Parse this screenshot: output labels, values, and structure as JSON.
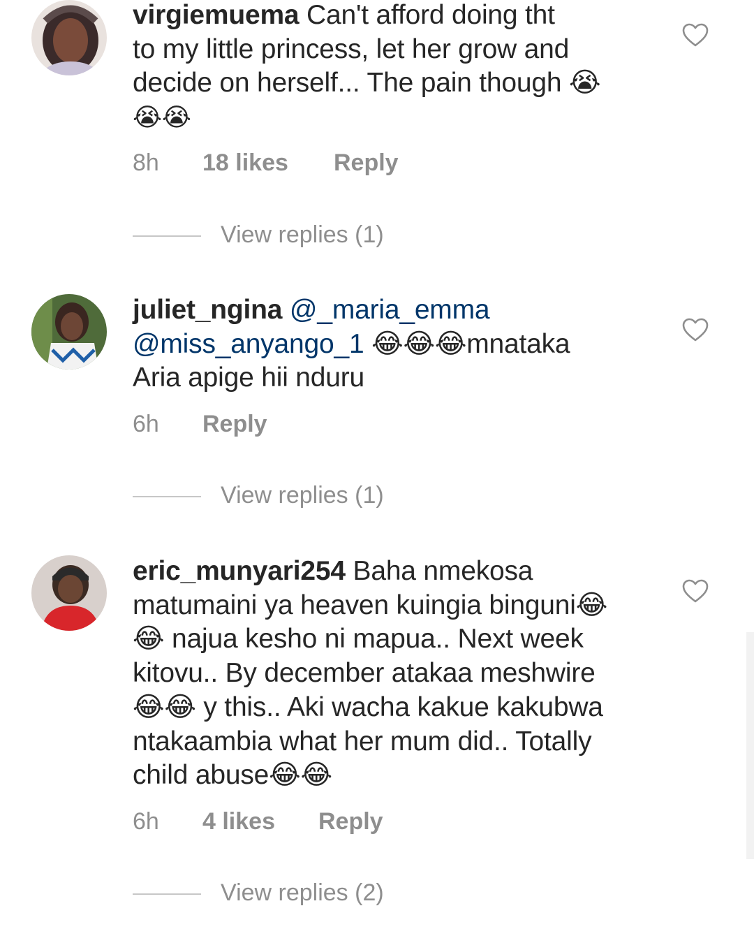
{
  "comments": [
    {
      "username": "virgiemuema",
      "lines": [
        " Can't afford doing tht",
        "to my little princess, let her grow and",
        "decide on herself... The pain though 😭",
        "😭😭"
      ],
      "time": "8h",
      "likes": "18 likes",
      "reply": "Reply",
      "view_replies": "View replies (1)"
    },
    {
      "username": "juliet_ngina",
      "line1_mention": " @_maria_emma",
      "line2_mention": "@miss_anyango_1",
      "line2_rest": " 😂😂😂mnataka",
      "line3": "Aria apige hii nduru",
      "time": "6h",
      "reply": "Reply",
      "view_replies": "View replies (1)"
    },
    {
      "username": "eric_munyari254",
      "lines": [
        " Baha nmekosa",
        "matumaini ya heaven kuingia binguni😂",
        "😂 najua kesho ni mapua.. Next week",
        "kitovu.. By december atakaa meshwire",
        "😂😂 y this.. Aki wacha kakue kakubwa",
        "ntakaambia what her mum did.. Totally",
        "child abuse😂😂"
      ],
      "time": "6h",
      "likes": "4 likes",
      "reply": "Reply",
      "view_replies": "View replies (2)"
    }
  ],
  "icons": {
    "like": "heart-outline-icon"
  },
  "colors": {
    "text": "#262626",
    "secondary": "#8e8e8e",
    "mention": "#003569",
    "divider": "#c7c7c7"
  }
}
